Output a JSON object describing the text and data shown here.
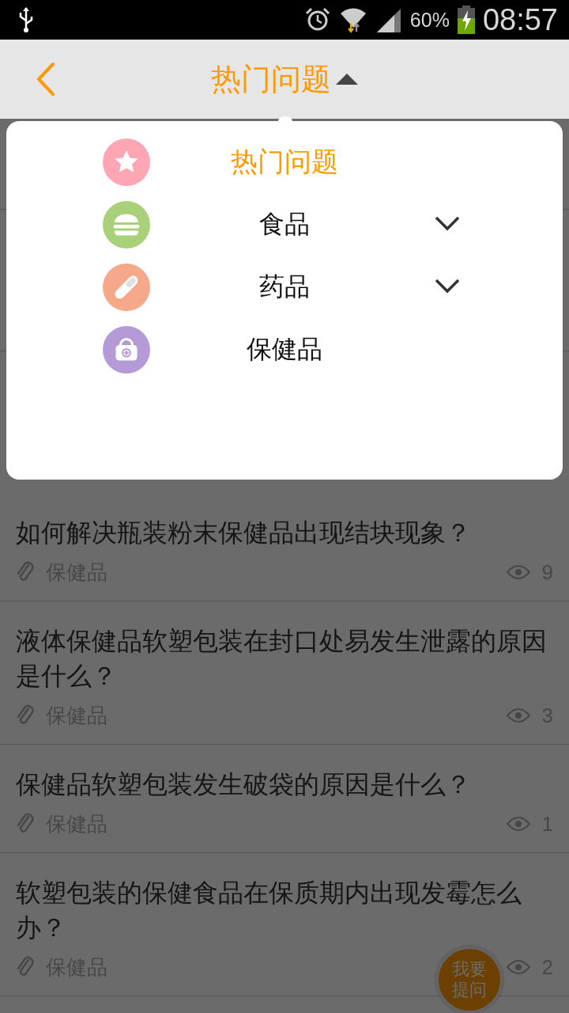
{
  "status_bar": {
    "battery": "60%",
    "time": "08:57"
  },
  "header": {
    "title": "热门问题"
  },
  "menu": {
    "items": [
      {
        "label": "热门问题",
        "selected": true,
        "expandable": false,
        "kind": "star",
        "color": "#ffa6b4"
      },
      {
        "label": "食品",
        "selected": false,
        "expandable": true,
        "kind": "burger",
        "color": "#a8d17a"
      },
      {
        "label": "药品",
        "selected": false,
        "expandable": true,
        "kind": "pill",
        "color": "#f5a98a"
      },
      {
        "label": "保健品",
        "selected": false,
        "expandable": false,
        "kind": "kit",
        "color": "#b59ad8"
      }
    ]
  },
  "questions": [
    {
      "title": "如何解决瓶装粉末保健品出现结块现象？",
      "category": "保健品",
      "views": "9"
    },
    {
      "title": "液体保健品软塑包装在封口处易发生泄露的原因是什么？",
      "category": "保健品",
      "views": "3"
    },
    {
      "title": "保健品软塑包装发生破袋的原因是什么？",
      "category": "保健品",
      "views": "1"
    },
    {
      "title": "软塑包装的保健食品在保质期内出现发霉怎么办？",
      "category": "保健品",
      "views": "2"
    }
  ],
  "fab": {
    "label": "我要提问"
  }
}
